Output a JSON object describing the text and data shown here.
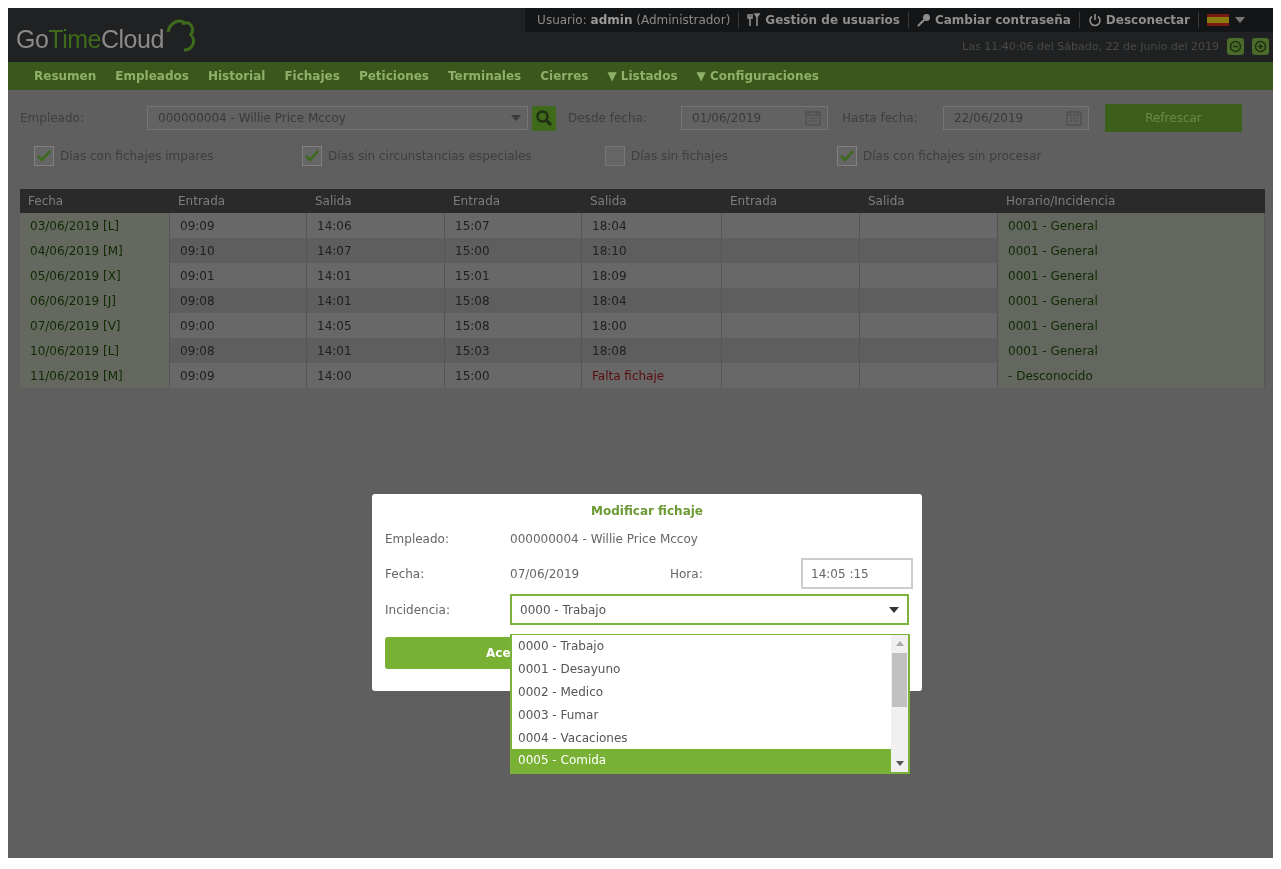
{
  "header": {
    "logo": [
      {
        "text": "Go",
        "accent": false
      },
      {
        "text": "Time",
        "accent": true
      },
      {
        "text": "Cloud",
        "accent": false
      }
    ],
    "user": "Usuario: **admin** (Administrador)",
    "links": [
      {
        "kind": "tools",
        "label": "Gestión de usuarios"
      },
      {
        "kind": "key",
        "label": "Cambiar contraseña"
      },
      {
        "kind": "power",
        "label": "Desconectar"
      }
    ],
    "datetime": "Las 11:40:06 del Sábado, 22 de Junio del 2019"
  },
  "nav": [
    "Resumen",
    "Empleados",
    "Historial",
    "Fichajes",
    "Peticiones",
    "Terminales",
    "Cierres",
    "▼ Listados",
    "▼ Configuraciones"
  ],
  "filters": {
    "employee_label": "Empleado:",
    "employee": "000000004 - Willie Price Mccoy",
    "from_label": "Desde fecha:",
    "from": "01/06/2019",
    "to_label": "Hasta fecha:",
    "to": "22/06/2019",
    "refresh": "Refrescar",
    "options": [
      {
        "label": "Días con fichajes impares",
        "checked": true
      },
      {
        "label": "Días sin circunstancias especiales",
        "checked": true
      },
      {
        "label": "Días sin fichajes",
        "checked": false
      },
      {
        "label": "Días con fichajes sin procesar",
        "checked": true
      }
    ]
  },
  "table": {
    "columns": [
      "Fecha",
      "Entrada",
      "Salida",
      "Entrada",
      "Salida",
      "Entrada",
      "Salida",
      "Horario/Incidencia"
    ],
    "rows": [
      {
        "date": "03/06/2019 [L]",
        "times": [
          "09:09",
          "14:06",
          "15:07",
          "18:04"
        ],
        "schedule": "0001 - General"
      },
      {
        "date": "04/06/2019 [M]",
        "times": [
          "09:10",
          "14:07",
          "15:00",
          "18:10"
        ],
        "schedule": "0001 - General"
      },
      {
        "date": "05/06/2019 [X]",
        "times": [
          "09:01",
          "14:01",
          "15:01",
          "18:09"
        ],
        "schedule": "0001 - General"
      },
      {
        "date": "06/06/2019 [J]",
        "times": [
          "09:08",
          "14:01",
          "15:08",
          "18:04"
        ],
        "schedule": "0001 - General"
      },
      {
        "date": "07/06/2019 [V]",
        "times": [
          "09:00",
          "14:05",
          "15:08",
          "18:00"
        ],
        "schedule": "0001 - General"
      },
      {
        "date": "10/06/2019 [L]",
        "times": [
          "09:08",
          "14:01",
          "15:03",
          "18:08"
        ],
        "schedule": "0001 - General"
      },
      {
        "date": "11/06/2019 [M]",
        "times": [
          "09:09",
          "14:00",
          "15:00",
          {
            "text": "Falta fichaje",
            "kind": "missing"
          }
        ],
        "schedule": "- Desconocido"
      }
    ]
  },
  "dialog": {
    "title": "Modificar fichaje",
    "employee_label": "Empleado:",
    "employee": "000000004 - Willie Price Mccoy",
    "date_label": "Fecha:",
    "date": "07/06/2019",
    "time_label": "Hora:",
    "time": "14:05 :15",
    "incidence_label": "Incidencia:",
    "incidence": "0000 - Trabajo",
    "accept": "Ace",
    "options": [
      {
        "label": "0000 - Trabajo",
        "selected": false
      },
      {
        "label": "0001 - Desayuno",
        "selected": false
      },
      {
        "label": "0002 - Medico",
        "selected": false
      },
      {
        "label": "0003 - Fumar",
        "selected": false
      },
      {
        "label": "0004 - Vacaciones",
        "selected": false
      },
      {
        "label": "0005 - Comida",
        "selected": true
      }
    ]
  }
}
